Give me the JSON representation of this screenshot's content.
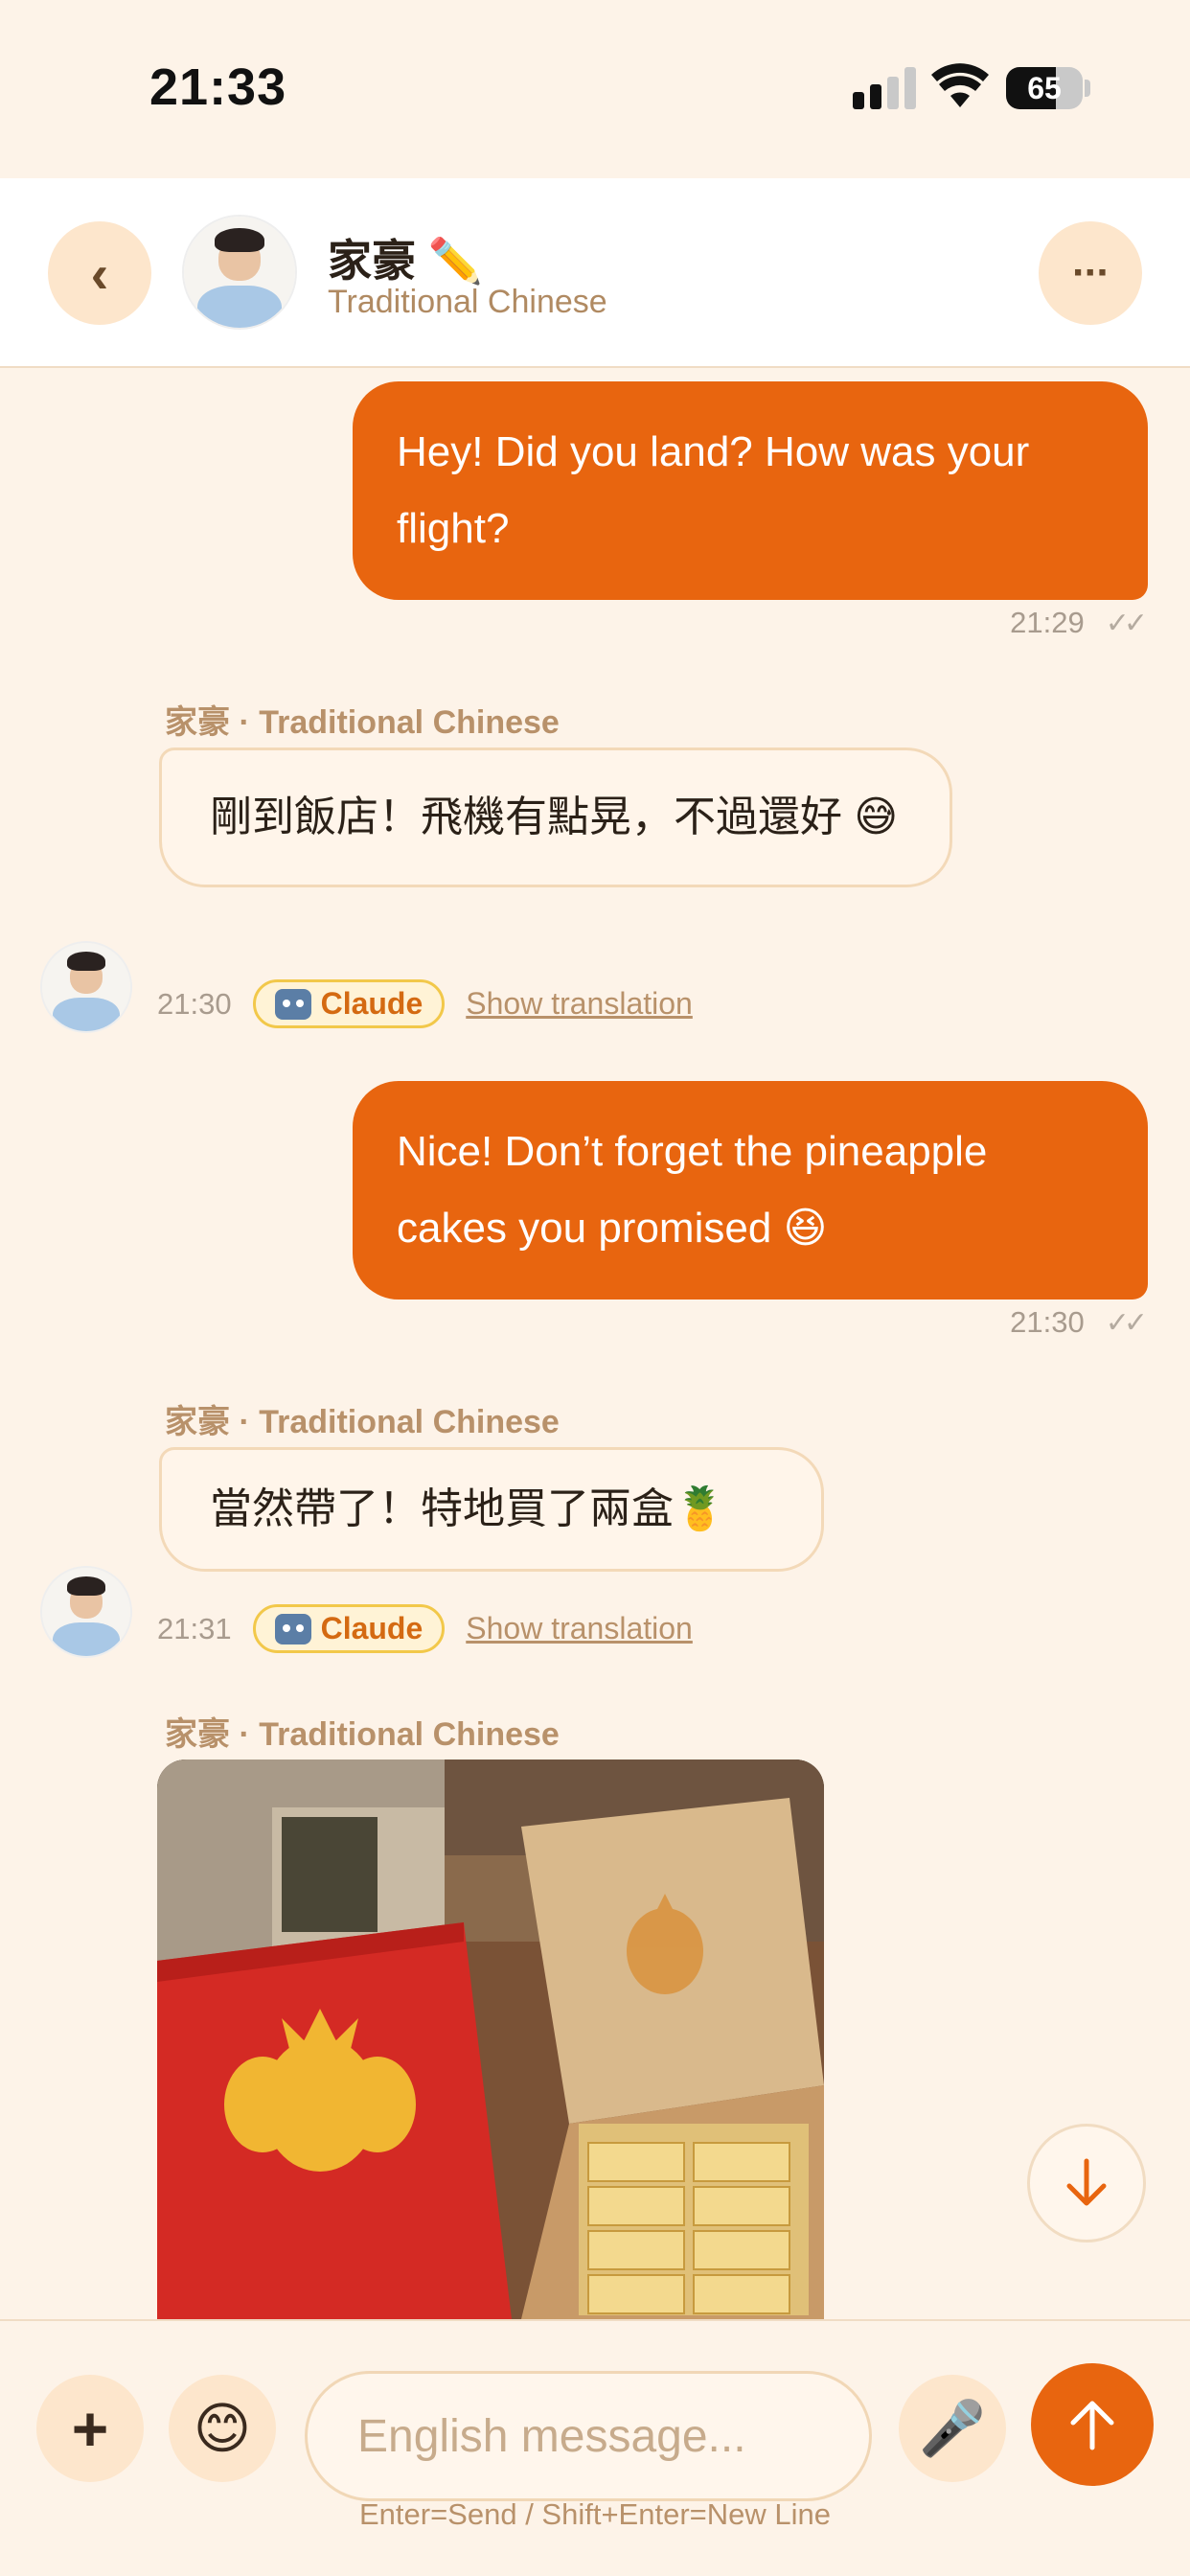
{
  "status_bar": {
    "time": "21:33",
    "battery": "65",
    "battery_level": 0.65
  },
  "header": {
    "back_label": "‹",
    "contact_name": "家豪 ✏️",
    "contact_language": "Traditional Chinese",
    "more_label": "···"
  },
  "messages": [
    {
      "direction": "out",
      "text": "Hey! Did you land? How was your flight?",
      "time": "21:29",
      "ticks": "✓✓"
    },
    {
      "direction": "in",
      "sender": "家豪 · Traditional Chinese",
      "text": "剛到飯店！飛機有點晃，不過還好 😅",
      "time": "21:30",
      "badge": "Claude",
      "translate_label": "Show translation"
    },
    {
      "direction": "out",
      "text": "Nice! Don’t forget the pineapple cakes you promised 😆",
      "time": "21:30",
      "ticks": "✓✓"
    },
    {
      "direction": "in",
      "sender": "家豪 · Traditional Chinese",
      "text": "當然帶了！特地買了兩盒🍍",
      "time": "21:31",
      "badge": "Claude",
      "translate_label": "Show translation"
    },
    {
      "direction": "in",
      "sender": "家豪 · Traditional Chinese",
      "type": "image"
    }
  ],
  "composer": {
    "plus_label": "+",
    "emoji_label": "😊",
    "placeholder": "English message...",
    "mic_label": "🎤",
    "hint": "Enter=Send / Shift+Enter=New Line"
  },
  "colors": {
    "accent": "#e8650f",
    "background": "#fdf3e8",
    "badge_border": "#f2c84a"
  },
  "icons": [
    "back-icon",
    "more-icon",
    "robot-icon",
    "scroll-down-icon",
    "plus-icon",
    "emoji-icon",
    "mic-icon",
    "send-arrow-icon"
  ]
}
